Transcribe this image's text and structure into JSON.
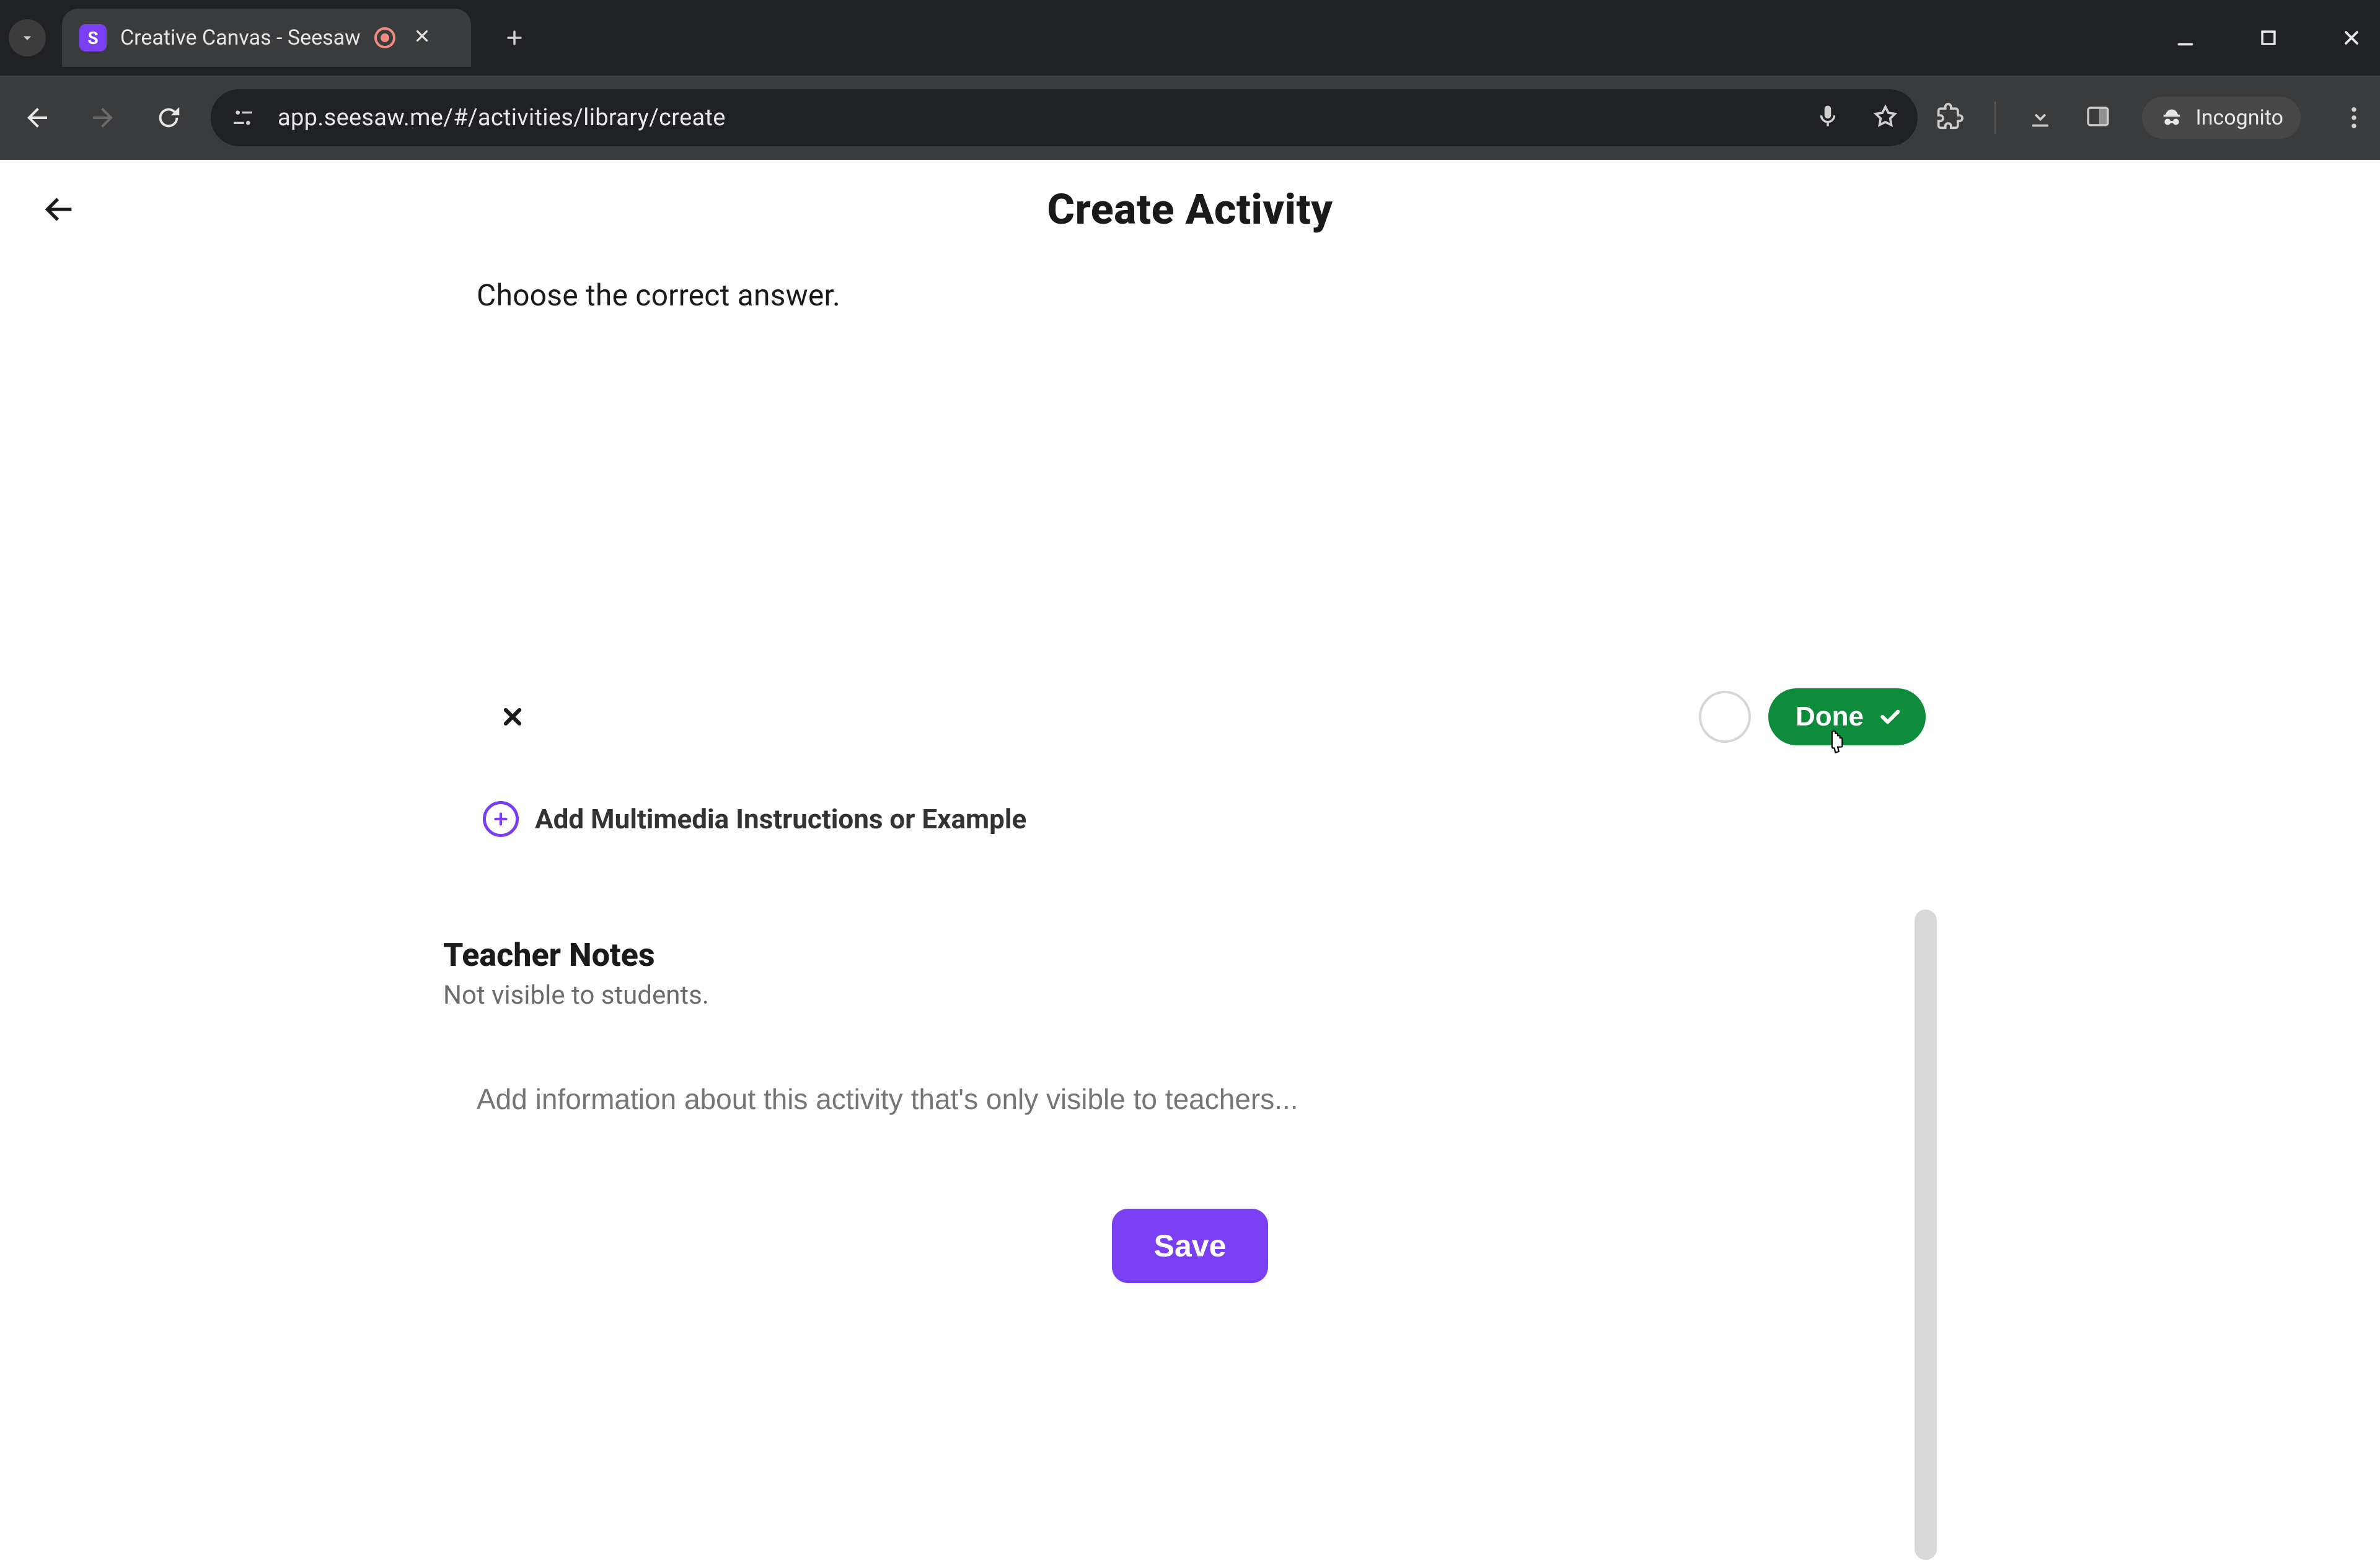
{
  "browser": {
    "tab_title": "Creative Canvas - Seesaw",
    "favicon_glyph": "S",
    "url": "app.seesaw.me/#/activities/library/create",
    "incognito_label": "Incognito"
  },
  "header": {
    "title": "Create Activity"
  },
  "main": {
    "instruction_text": "Choose the correct answer.",
    "done_label": "Done",
    "add_multimedia_label": "Add Multimedia Instructions or Example",
    "teacher_notes_title": "Teacher Notes",
    "teacher_notes_subtitle": "Not visible to students.",
    "teacher_notes_placeholder": "Add information about this activity that's only visible to teachers...",
    "save_label": "Save"
  },
  "colors": {
    "brand_purple": "#7a3ff2",
    "done_green": "#0f8b3c"
  }
}
